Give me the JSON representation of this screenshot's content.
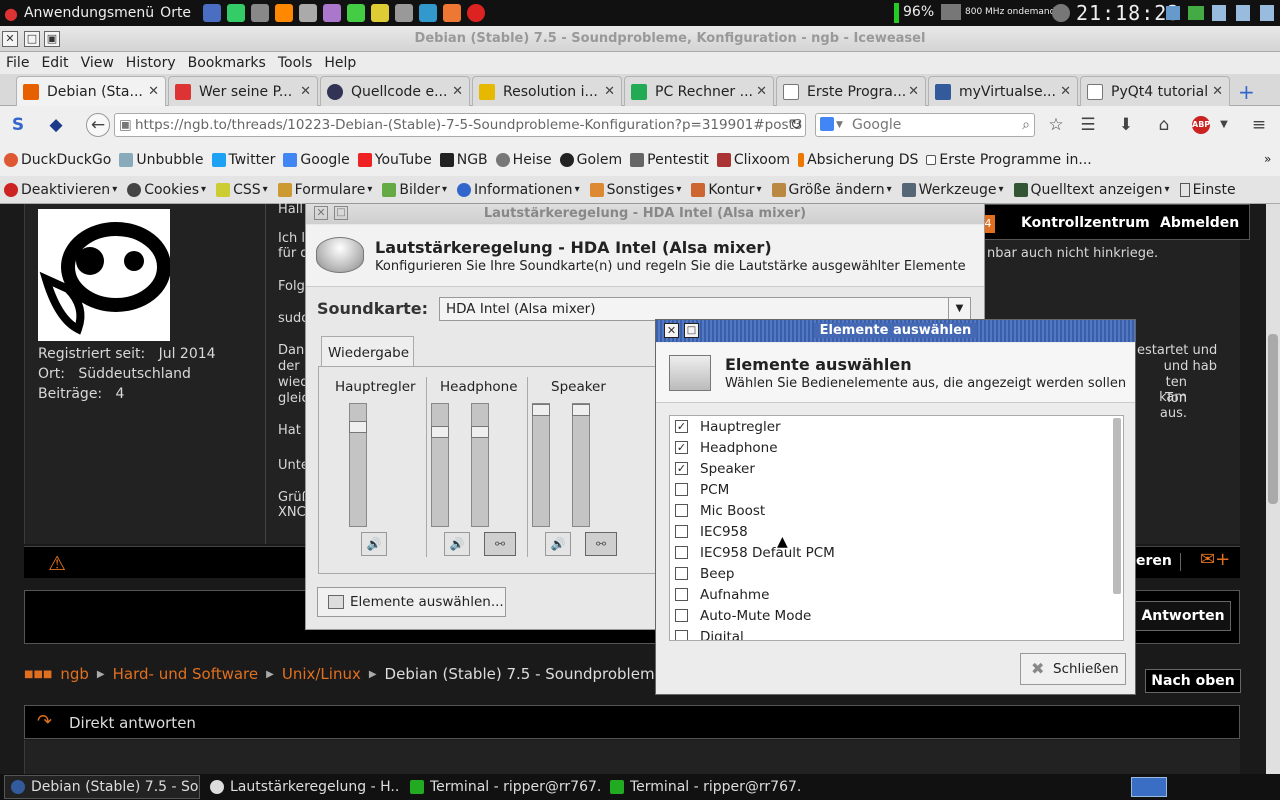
{
  "top_panel": {
    "apps_menu": "Anwendungsmenü",
    "places_menu": "Orte",
    "battery": "96%",
    "cpu_freq": "800 MHz ondemand",
    "clock": "21:18:23"
  },
  "browser": {
    "window_title": "Debian (Stable) 7.5 - Soundprobleme, Konfiguration - ngb - Iceweasel",
    "menu": [
      "File",
      "Edit",
      "View",
      "History",
      "Bookmarks",
      "Tools",
      "Help"
    ],
    "tabs": [
      {
        "label": "Debian (Sta...",
        "color": "#e66000"
      },
      {
        "label": "Wer seine P...",
        "color": "#d33"
      },
      {
        "label": "Quellcode e...",
        "color": "#335"
      },
      {
        "label": "Resolution i...",
        "color": "#e6b800"
      },
      {
        "label": "PC Rechner ...",
        "color": "#2a5"
      },
      {
        "label": "Erste Progra...",
        "color": "#999"
      },
      {
        "label": "myVirtualse...",
        "color": "#335a9a"
      },
      {
        "label": "PyQt4 tutorial",
        "color": "#999"
      }
    ],
    "url": "https://ngb.to/threads/10223-Debian-(Stable)-7-5-Soundprobleme-Konfiguration?p=319901#post3",
    "search_placeholder": "Google",
    "bookmarks": [
      "DuckDuckGo",
      "Unbubble",
      "Twitter",
      "Google",
      "YouTube",
      "NGB",
      "Heise",
      "Golem",
      "Pentestit",
      "Clixoom",
      "Absicherung DS",
      "Erste Programme in..."
    ],
    "devtools": [
      "Deaktivieren",
      "Cookies",
      "CSS",
      "Formulare",
      "Bilder",
      "Informationen",
      "Sonstiges",
      "Kontur",
      "Größe ändern",
      "Werkzeuge",
      "Quelltext anzeigen",
      "Einste"
    ]
  },
  "page": {
    "member_since_label": "Registriert seit:",
    "member_since": "Jul 2014",
    "location_label": "Ort:",
    "location": "Süddeutschland",
    "posts_label": "Beiträge:",
    "posts": "4",
    "control_center": "Kontrollzentrum",
    "logout": "Abmelden",
    "badge": "4",
    "post_fragments": {
      "l1": "Hall",
      "l2": "Ich l",
      "l2b": "für d",
      "l3": "Folg",
      "l4": "sudo",
      "l5": "Dan",
      "l5b": "der",
      "l5c": "wied",
      "l5d": "gleic",
      "l6": "Hat",
      "l7": "Unte",
      "l8": "Grüß",
      "l8b": "XNC",
      "r1": "nbar auch nicht hinkriege.",
      "r2": "estartet und",
      "r3": "und hab",
      "r4": "ten kam",
      "r5": "Ton aus."
    },
    "quote_fragment": "eren",
    "reply_button": "Antworten",
    "breadcrumbs": [
      "ngb",
      "Hard- und Software",
      "Unix/Linux",
      "Debian (Stable) 7.5 - Soundprobleme, K"
    ],
    "back_to_top": "Nach oben",
    "quick_reply": "Direkt antworten"
  },
  "mixer": {
    "window_title": "Lautstärkeregelung - HDA Intel (Alsa mixer)",
    "heading": "Lautstärkeregelung - HDA Intel (Alsa mixer)",
    "subheading": "Konfigurieren Sie Ihre Soundkarte(n) und regeln Sie die Lautstärke ausgewählter Elemente",
    "soundcard_label": "Soundkarte:",
    "soundcard_value": "HDA Intel (Alsa mixer)",
    "tab_playback": "Wiedergabe",
    "channels": [
      {
        "name": "Hauptregler",
        "levels": [
          0.85
        ]
      },
      {
        "name": "Headphone",
        "levels": [
          0.8,
          0.8
        ]
      },
      {
        "name": "Speaker",
        "levels": [
          1.0,
          1.0
        ]
      }
    ],
    "select_button": "Elemente auswählen..."
  },
  "select_dialog": {
    "window_title": "Elemente auswählen",
    "heading": "Elemente auswählen",
    "subheading": "Wählen Sie Bedienelemente aus, die angezeigt werden sollen",
    "items": [
      {
        "label": "Hauptregler",
        "checked": true
      },
      {
        "label": "Headphone",
        "checked": true
      },
      {
        "label": "Speaker",
        "checked": true
      },
      {
        "label": "PCM",
        "checked": false
      },
      {
        "label": "Mic Boost",
        "checked": false
      },
      {
        "label": "IEC958",
        "checked": false
      },
      {
        "label": "IEC958 Default PCM",
        "checked": false
      },
      {
        "label": "Beep",
        "checked": false
      },
      {
        "label": "Aufnahme",
        "checked": false
      },
      {
        "label": "Auto-Mute Mode",
        "checked": false
      },
      {
        "label": "Digital",
        "checked": false
      }
    ],
    "close_button": "Schließen"
  },
  "taskbar": [
    {
      "label": "Debian (Stable) 7.5 - So...",
      "color": "#335a9a"
    },
    {
      "label": "Lautstärkeregelung - H...",
      "color": "#ddd"
    },
    {
      "label": "Terminal - ripper@rr767...",
      "color": "#2a2"
    },
    {
      "label": "Terminal - ripper@rr767...",
      "color": "#2a2"
    }
  ],
  "colors": {
    "accent": "#e07020",
    "dialog_title": "#4468b4"
  }
}
